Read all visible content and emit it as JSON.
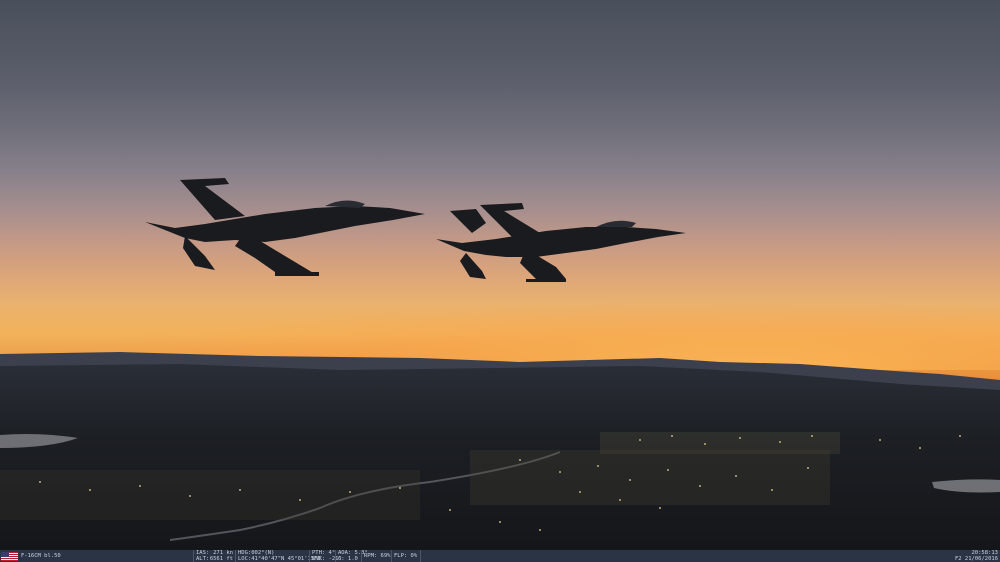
{
  "hud": {
    "aircraft": "F-16CM bl.50",
    "ias_label": "IAS:",
    "ias_value": "271 kn",
    "alt_label": "ALT:",
    "alt_value": "6561 ft",
    "hdg": "HDG:002°(N)",
    "loc": "LOC:41°40'47\"N 45°01'15\"E",
    "pth": "PTH: 4°",
    "bnk": "BNK: -21°",
    "aoa": "AOA: 5.3°",
    "g": "G: 1.0",
    "rpm": "RPM: 69%",
    "flp": "FLP: 0%",
    "time": "20:58:13",
    "date": "F2 21/06/2016",
    "flag_icon": "us-flag-icon"
  }
}
